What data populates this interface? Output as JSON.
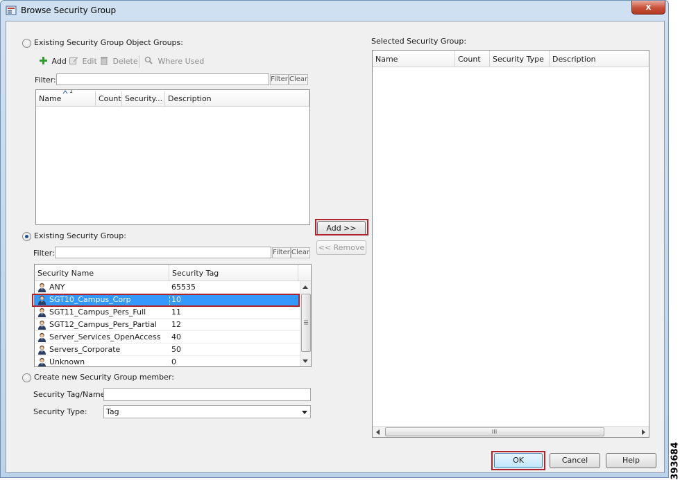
{
  "window": {
    "title": "Browse Security Group",
    "close_glyph": "x"
  },
  "object_groups": {
    "radio_label": "Existing Security Group Object Groups:",
    "toolbar": {
      "add": "Add",
      "edit": "Edit",
      "delete": "Delete",
      "where_used": "Where Used"
    },
    "filter_label": "Filter:",
    "filter_value": "",
    "filter_btn": "Filter",
    "clear_btn": "Clear",
    "sort_indicator": "1",
    "columns": [
      "Name",
      "Count",
      "Security...",
      "Description"
    ]
  },
  "transfer": {
    "add": "Add >>",
    "remove": "<< Remove"
  },
  "security_group": {
    "radio_label": "Existing Security Group:",
    "filter_label": "Filter:",
    "filter_value": "",
    "filter_btn": "Filter",
    "clear_btn": "Clear",
    "columns": [
      "Security Name",
      "Security Tag"
    ],
    "rows": [
      {
        "name": "ANY",
        "tag": "65535",
        "selected": false
      },
      {
        "name": "SGT10_Campus_Corp",
        "tag": "10",
        "selected": true
      },
      {
        "name": "SGT11_Campus_Pers_Full",
        "tag": "11",
        "selected": false
      },
      {
        "name": "SGT12_Campus_Pers_Partial",
        "tag": "12",
        "selected": false
      },
      {
        "name": "Server_Services_OpenAccess",
        "tag": "40",
        "selected": false
      },
      {
        "name": "Servers_Corporate",
        "tag": "50",
        "selected": false
      },
      {
        "name": "Unknown",
        "tag": "0",
        "selected": false
      }
    ]
  },
  "create_member": {
    "radio_label": "Create new Security Group member:",
    "tag_name_label": "Security Tag/Name:",
    "tag_name_value": "",
    "type_label": "Security Type:",
    "type_value": "Tag"
  },
  "selected": {
    "label": "Selected Security Group:",
    "columns": [
      "Name",
      "Count",
      "Security Type",
      "Description"
    ]
  },
  "footer": {
    "ok": "OK",
    "cancel": "Cancel",
    "help": "Help"
  },
  "figure_id": "393684",
  "colors": {
    "selection": "#3399ff",
    "highlight_border": "#b1242e",
    "add_icon": "#2e9d2e"
  }
}
